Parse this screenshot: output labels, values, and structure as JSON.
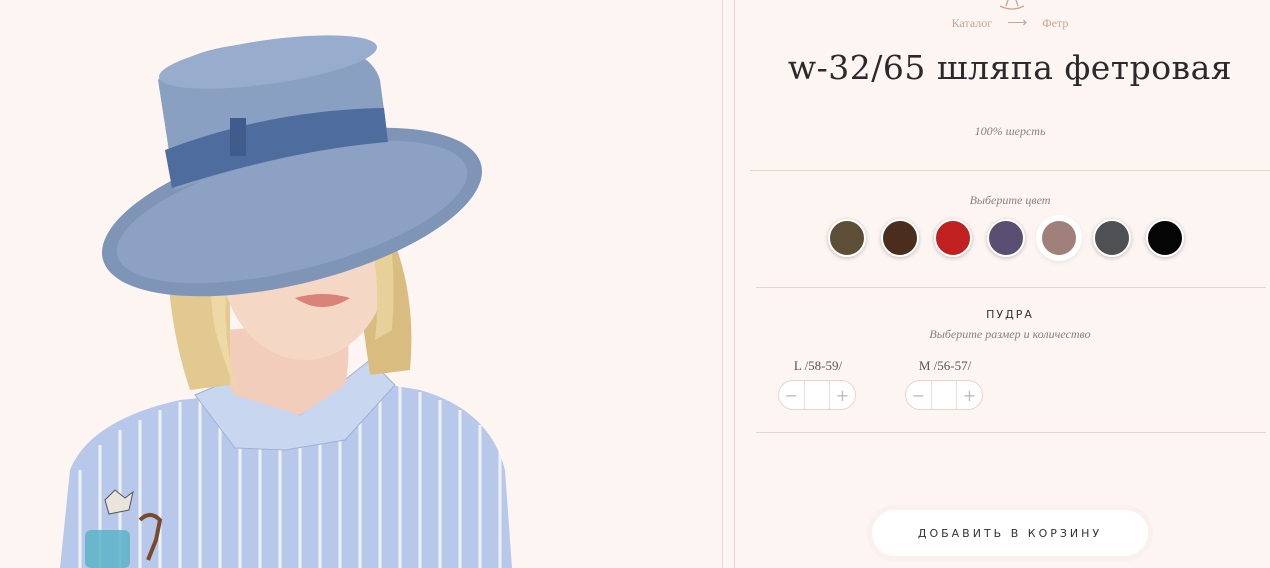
{
  "product": {
    "breadcrumb": [
      "Каталог",
      "Фетр"
    ],
    "title": "w-32/65 шляпа фетровая",
    "material": "100% шерсть"
  },
  "colors": {
    "label": "Выберите цвет",
    "swatches": [
      {
        "hex": "#5d4f37"
      },
      {
        "hex": "#4b2d1e"
      },
      {
        "hex": "#c0201f"
      },
      {
        "hex": "#5a4f73"
      },
      {
        "hex": "#a0807a",
        "selected": true
      },
      {
        "hex": "#4e5053"
      },
      {
        "hex": "#050505"
      }
    ],
    "selected_name": "ПУДРА"
  },
  "sizes": {
    "label": "Выберите размер и количество",
    "items": [
      {
        "name": "L /58-59/",
        "qty": ""
      },
      {
        "name": "M /56-57/",
        "qty": ""
      }
    ],
    "minus": "−",
    "plus": "+"
  },
  "cart": {
    "label": "ДОБАВИТЬ В КОРЗИНУ"
  },
  "icons": {
    "top": "hat-icon",
    "arrow": "arrow-right-icon"
  }
}
